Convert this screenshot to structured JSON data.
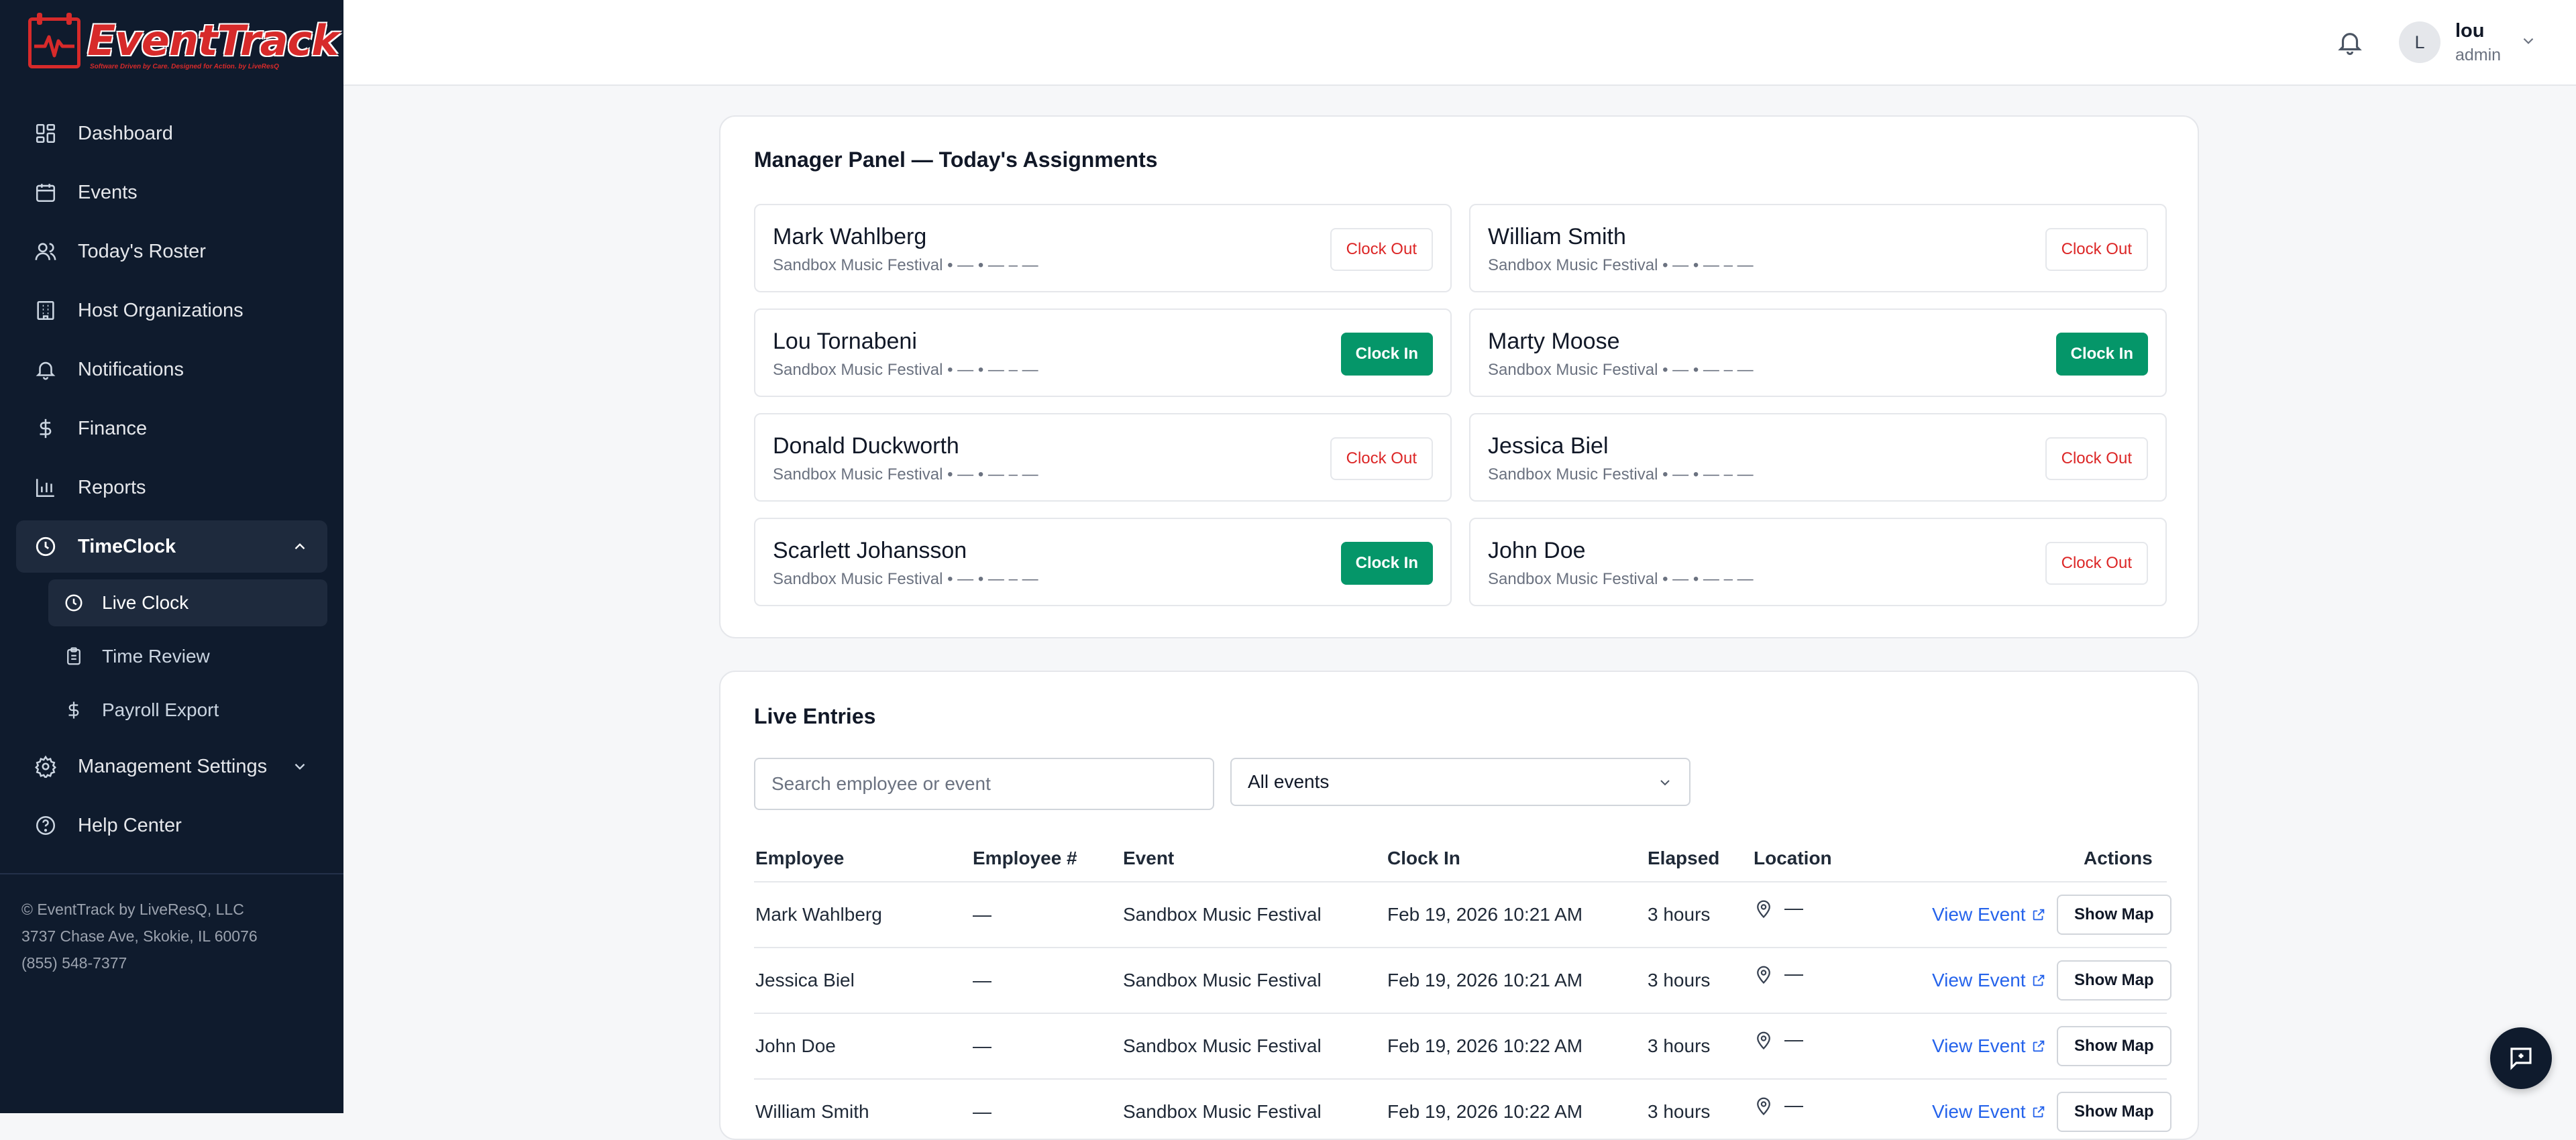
{
  "brand": {
    "name": "EventTrack",
    "tagline": "Software Driven by Care. Designed for Action.    by LiveResQ"
  },
  "sidebar": {
    "items": [
      {
        "label": "Dashboard",
        "icon": "dashboard-icon"
      },
      {
        "label": "Events",
        "icon": "calendar-icon"
      },
      {
        "label": "Today's Roster",
        "icon": "users-icon"
      },
      {
        "label": "Host Organizations",
        "icon": "building-icon"
      },
      {
        "label": "Notifications",
        "icon": "bell-icon"
      },
      {
        "label": "Finance",
        "icon": "dollar-icon"
      },
      {
        "label": "Reports",
        "icon": "bar-chart-icon"
      },
      {
        "label": "TimeClock",
        "icon": "clock-icon",
        "expanded": true
      },
      {
        "label": "Management Settings",
        "icon": "gear-icon",
        "expanded": false
      },
      {
        "label": "Help Center",
        "icon": "help-icon"
      }
    ],
    "timeclock_sub": [
      {
        "label": "Live Clock",
        "icon": "clock-icon",
        "active": true
      },
      {
        "label": "Time Review",
        "icon": "clipboard-icon"
      },
      {
        "label": "Payroll Export",
        "icon": "dollar-icon"
      }
    ],
    "footer": {
      "line1": "© EventTrack by LiveResQ, LLC",
      "line2": "3737 Chase Ave, Skokie, IL 60076",
      "line3": "(855) 548-7377"
    }
  },
  "user": {
    "initial": "L",
    "name": "lou",
    "role": "admin"
  },
  "manager_panel": {
    "title": "Manager Panel — Today's Assignments",
    "assignments": [
      {
        "name": "Mark Wahlberg",
        "sub": "Sandbox Music Festival • — • — – —",
        "action": "Clock Out"
      },
      {
        "name": "William Smith",
        "sub": "Sandbox Music Festival • — • — – —",
        "action": "Clock Out"
      },
      {
        "name": "Lou Tornabeni",
        "sub": "Sandbox Music Festival • — • — – —",
        "action": "Clock In"
      },
      {
        "name": "Marty Moose",
        "sub": "Sandbox Music Festival • — • — – —",
        "action": "Clock In"
      },
      {
        "name": "Donald Duckworth",
        "sub": "Sandbox Music Festival • — • — – —",
        "action": "Clock Out"
      },
      {
        "name": "Jessica Biel",
        "sub": "Sandbox Music Festival • — • — – —",
        "action": "Clock Out"
      },
      {
        "name": "Scarlett Johansson",
        "sub": "Sandbox Music Festival • — • — – —",
        "action": "Clock In"
      },
      {
        "name": "John Doe",
        "sub": "Sandbox Music Festival • — • — – —",
        "action": "Clock Out"
      }
    ]
  },
  "live_entries": {
    "title": "Live Entries",
    "search_placeholder": "Search employee or event",
    "filter_value": "All events",
    "columns": [
      "Employee",
      "Employee #",
      "Event",
      "Clock In",
      "Elapsed",
      "Location",
      "Actions"
    ],
    "rows": [
      {
        "employee": "Mark Wahlberg",
        "number": "—",
        "event": "Sandbox Music Festival",
        "clock_in": "Feb 19, 2026 10:21 AM",
        "elapsed": "3 hours",
        "location": "—",
        "view": "View Event",
        "map": "Show Map"
      },
      {
        "employee": "Jessica Biel",
        "number": "—",
        "event": "Sandbox Music Festival",
        "clock_in": "Feb 19, 2026 10:21 AM",
        "elapsed": "3 hours",
        "location": "—",
        "view": "View Event",
        "map": "Show Map"
      },
      {
        "employee": "John Doe",
        "number": "—",
        "event": "Sandbox Music Festival",
        "clock_in": "Feb 19, 2026 10:22 AM",
        "elapsed": "3 hours",
        "location": "—",
        "view": "View Event",
        "map": "Show Map"
      },
      {
        "employee": "William Smith",
        "number": "—",
        "event": "Sandbox Music Festival",
        "clock_in": "Feb 19, 2026 10:22 AM",
        "elapsed": "3 hours",
        "location": "—",
        "view": "View Event",
        "map": "Show Map"
      }
    ]
  },
  "colors": {
    "sidebar_bg": "#0f1b2d",
    "brand_red": "#d72a2a",
    "clock_in_green": "#059669",
    "clock_out_red": "#dc2626",
    "link_blue": "#2563eb"
  }
}
